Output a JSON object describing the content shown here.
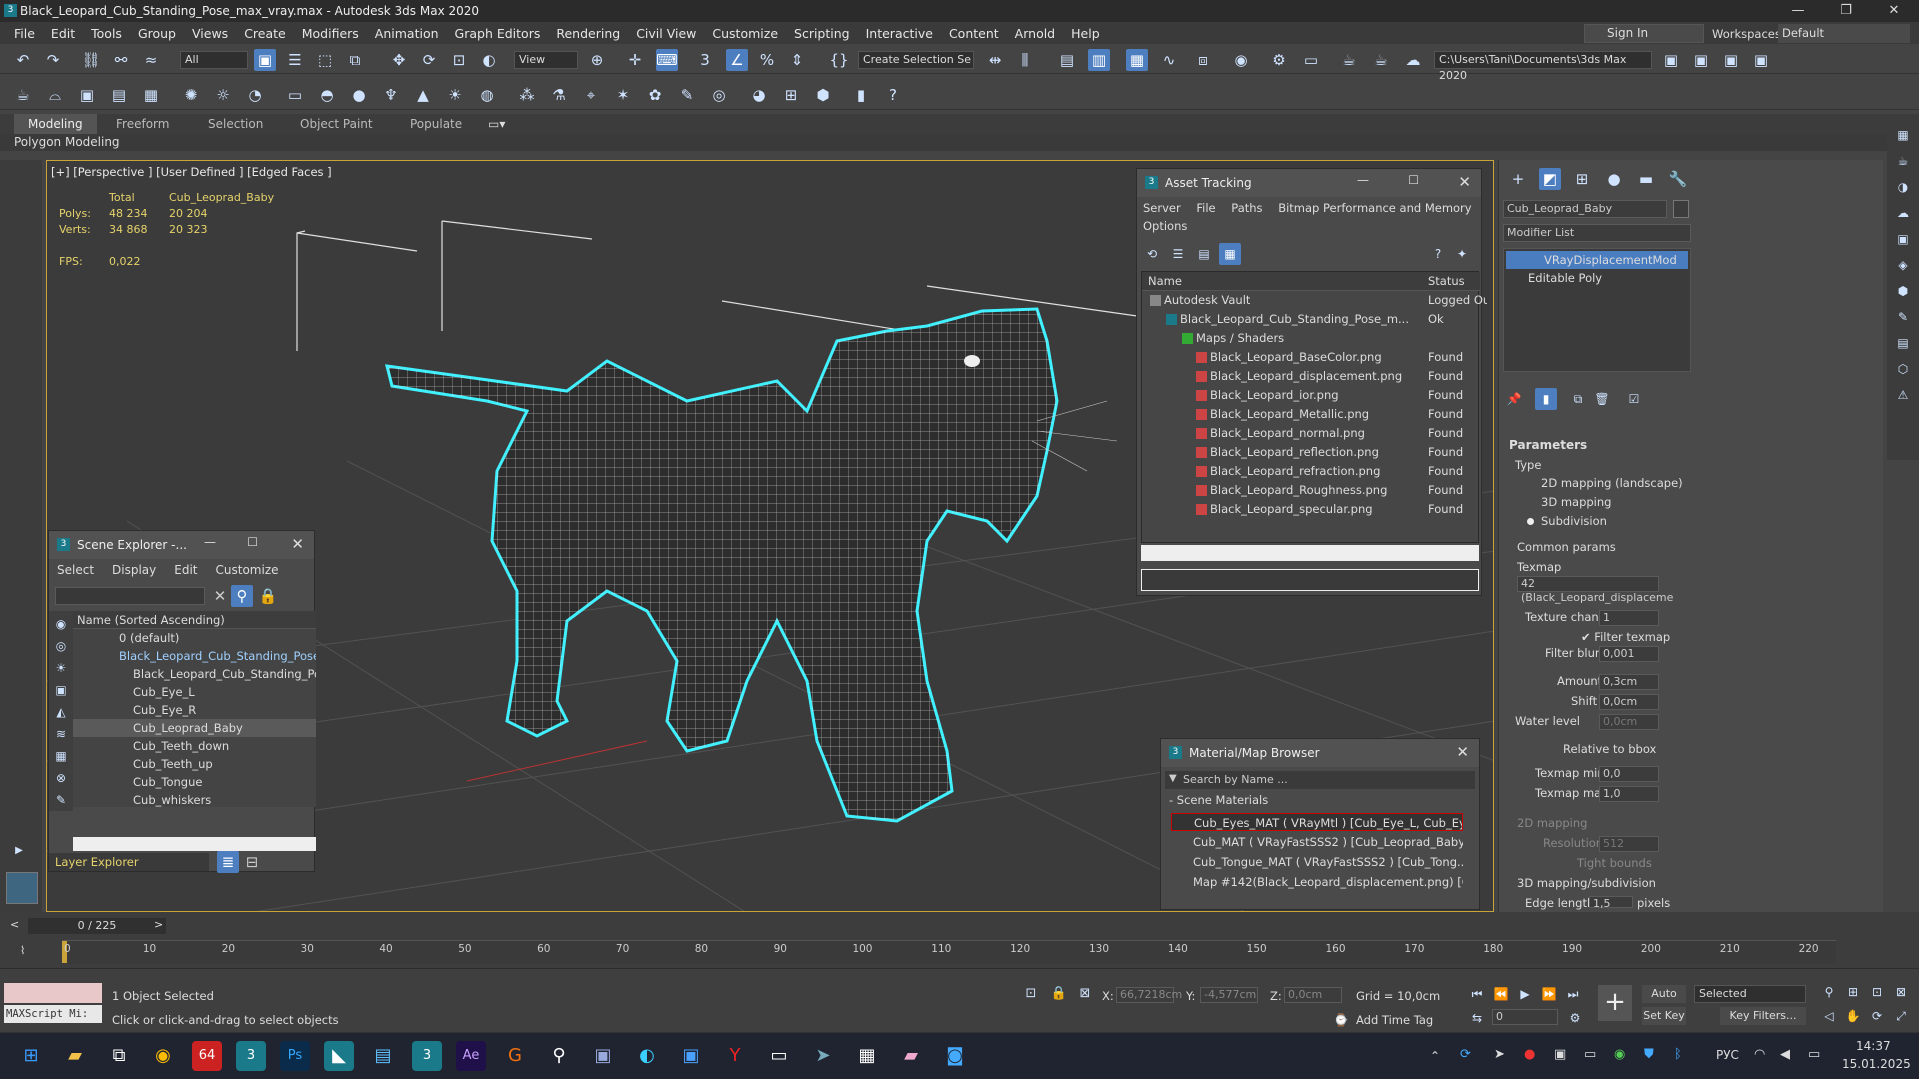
{
  "title": "Black_Leopard_Cub_Standing_Pose_max_vray.max - Autodesk 3ds Max 2020",
  "menu": [
    "File",
    "Edit",
    "Tools",
    "Group",
    "Views",
    "Create",
    "Modifiers",
    "Animation",
    "Graph Editors",
    "Rendering",
    "Civil View",
    "Customize",
    "Scripting",
    "Interactive",
    "Content",
    "Arnold",
    "Help"
  ],
  "signin": "Sign In",
  "workspaces_label": "Workspaces:",
  "workspace": "Default",
  "toolbar": {
    "filter": "All",
    "refcoord": "View",
    "selset": "Create Selection Se",
    "path": "C:\\Users\\Tani\\Documents\\3ds Max 2020"
  },
  "ribbon_tabs": [
    "Modeling",
    "Freeform",
    "Selection",
    "Object Paint",
    "Populate"
  ],
  "polygon_modeling": "Polygon Modeling",
  "viewport": {
    "label": "[+] [Perspective ] [User Defined ] [Edged Faces ]",
    "stats_header_total": "Total",
    "stats_header_obj": "Cub_Leoprad_Baby",
    "polys_label": "Polys:",
    "polys_total": "48 234",
    "polys_obj": "20 204",
    "verts_label": "Verts:",
    "verts_total": "34 868",
    "verts_obj": "20 323",
    "fps_label": "FPS:",
    "fps": "0,022"
  },
  "scene_explorer": {
    "title": "Scene Explorer -...",
    "menu": [
      "Select",
      "Display",
      "Edit",
      "Customize"
    ],
    "column": "Name (Sorted Ascending)",
    "items": [
      "0 (default)",
      "Black_Leopard_Cub_Standing_Pose",
      "Black_Leopard_Cub_Standing_Pose",
      "Cub_Eye_L",
      "Cub_Eye_R",
      "Cub_Leoprad_Baby",
      "Cub_Teeth_down",
      "Cub_Teeth_up",
      "Cub_Tongue",
      "Cub_whiskers"
    ],
    "layer_explorer": "Layer Explorer"
  },
  "asset_tracking": {
    "title": "Asset Tracking",
    "menu": [
      "Server",
      "File",
      "Paths",
      "Bitmap Performance and Memory",
      "Options"
    ],
    "col_name": "Name",
    "col_status": "Status",
    "rows": [
      {
        "name": "Autodesk Vault",
        "status": "Logged Ou"
      },
      {
        "name": "Black_Leopard_Cub_Standing_Pose_m...",
        "status": "Ok"
      },
      {
        "name": "Maps / Shaders",
        "status": ""
      },
      {
        "name": "Black_Leopard_BaseColor.png",
        "status": "Found"
      },
      {
        "name": "Black_Leopard_displacement.png",
        "status": "Found"
      },
      {
        "name": "Black_Leopard_ior.png",
        "status": "Found"
      },
      {
        "name": "Black_Leopard_Metallic.png",
        "status": "Found"
      },
      {
        "name": "Black_Leopard_normal.png",
        "status": "Found"
      },
      {
        "name": "Black_Leopard_reflection.png",
        "status": "Found"
      },
      {
        "name": "Black_Leopard_refraction.png",
        "status": "Found"
      },
      {
        "name": "Black_Leopard_Roughness.png",
        "status": "Found"
      },
      {
        "name": "Black_Leopard_specular.png",
        "status": "Found"
      }
    ]
  },
  "material_browser": {
    "title": "Material/Map Browser",
    "search_placeholder": "Search by Name ...",
    "section": "- Scene Materials",
    "items": [
      "Cub_Eyes_MAT  ( VRayMtl )  [Cub_Eye_L, Cub_Ey...",
      "Cub_MAT  ( VRayFastSSS2 )  [Cub_Leoprad_Baby...",
      "Cub_Tongue_MAT  ( VRayFastSSS2 )  [Cub_Tong...",
      "Map #142(Black_Leopard_displacement.png)  [C..."
    ]
  },
  "command_panel": {
    "object_name": "Cub_Leoprad_Baby",
    "modifier_list": "Modifier List",
    "stack": [
      "VRayDisplacementMod",
      "Editable Poly"
    ],
    "parameters": "Parameters",
    "type_label": "Type",
    "types": [
      "2D mapping (landscape)",
      "3D mapping",
      "Subdivision"
    ],
    "common_params": "Common params",
    "texmap_label": "Texmap",
    "texmap_value": "42 (Black_Leopard_displaceme",
    "texture_chan_label": "Texture chan",
    "texture_chan": "1",
    "filter_texmap": "Filter texmap",
    "filter_blur_label": "Filter blur",
    "filter_blur": "0,001",
    "amount_label": "Amount",
    "amount": "0,3cm",
    "shift_label": "Shift",
    "shift": "0,0cm",
    "water_label": "Water level",
    "water": "0,0cm",
    "relative_bbox": "Relative to bbox",
    "texmap_min_label": "Texmap min",
    "texmap_min": "0,0",
    "texmap_max_label": "Texmap max",
    "texmap_max": "1,0",
    "mapping2d": "2D mapping",
    "resolution_label": "Resolution",
    "resolution": "512",
    "tight_bounds": "Tight bounds",
    "mapping3d": "3D mapping/subdivision",
    "edge_length_label": "Edge length",
    "edge_length": "1,5",
    "pixels": "pixels"
  },
  "timeline": {
    "frame": "0 / 225",
    "ticks": [
      "0",
      "10",
      "20",
      "30",
      "40",
      "50",
      "60",
      "70",
      "80",
      "90",
      "100",
      "110",
      "120",
      "130",
      "140",
      "150",
      "160",
      "170",
      "180",
      "190",
      "200",
      "210",
      "220"
    ]
  },
  "status": {
    "maxscript": "MAXScript Mi:",
    "selected": "1 Object Selected",
    "prompt": "Click or click-and-drag to select objects",
    "x_label": "X:",
    "x": "66,7218cm",
    "y_label": "Y:",
    "y": "-4,577cm",
    "z_label": "Z:",
    "z": "0,0cm",
    "grid": "Grid = 10,0cm",
    "add_time_tag": "Add Time Tag",
    "autokey": "Auto Key",
    "selected_dd": "Selected",
    "setkey": "Set Key",
    "keyfilters": "Key Filters...",
    "frame_field": "0"
  },
  "taskbar": {
    "lang": "РУС",
    "time": "14:37",
    "date": "15.01.2025"
  }
}
